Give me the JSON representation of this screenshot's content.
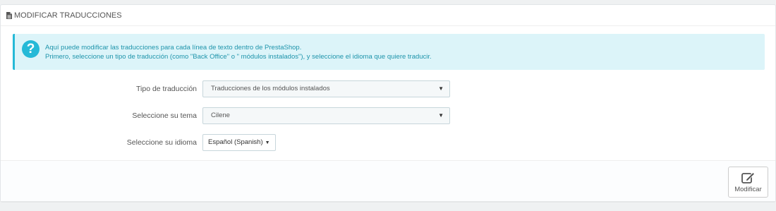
{
  "panel": {
    "title": "MODIFICAR TRADUCCIONES",
    "title_icon": "document-icon"
  },
  "alert": {
    "icon": "question-circle-icon",
    "line1": "Aquí puede modificar las traducciones para cada línea de texto dentro de PrestaShop.",
    "line2": "Primero, seleccione un tipo de traducción (como \"Back Office\" o \" módulos instalados\"), y seleccione el idioma que quiere traducir.",
    "accent_color": "#25b9d7"
  },
  "form": {
    "type_label": "Tipo de traducción",
    "type_value": "Traducciones de los módulos instalados",
    "theme_label": "Seleccione su tema",
    "theme_value": "Cilene",
    "language_label": "Seleccione su idioma",
    "language_value": "Español (Spanish)"
  },
  "footer": {
    "modify_label": "Modificar",
    "modify_icon": "edit-icon"
  }
}
